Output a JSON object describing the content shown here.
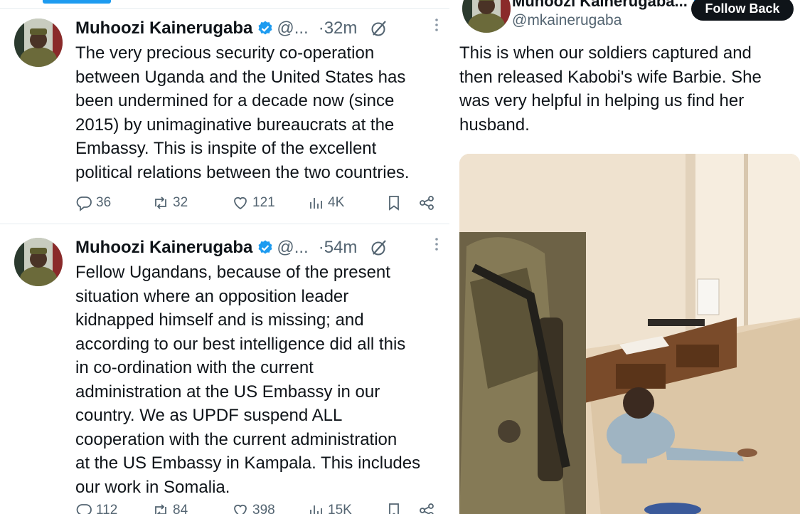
{
  "colors": {
    "text": "#0f1419",
    "muted": "#536471",
    "accent": "#1d9bf0",
    "button_bg": "#0f1419",
    "divider": "#e6ecf0"
  },
  "left_feed": {
    "tweets": [
      {
        "author": "Muhoozi Kainerugaba",
        "handle": "@...",
        "time": "·32m",
        "lines": [
          "The very precious security co-operation",
          "between Uganda and the United States has",
          "been undermined for a decade now (since",
          "2015) by unimaginative bureaucrats at the",
          "Embassy. This is inspite of the excellent",
          "political relations between the two countries."
        ],
        "replies": "36",
        "reposts": "32",
        "likes": "121",
        "views": "4K"
      },
      {
        "author": "Muhoozi Kainerugaba",
        "handle": "@...",
        "time": "·54m",
        "lines": [
          "Fellow Ugandans, because of the present",
          "situation where an opposition leader",
          "kidnapped himself and is missing; and",
          "according to our best intelligence did all this",
          "in co-ordination with the current",
          "administration at the US Embassy in our",
          "country. We as UPDF suspend ALL",
          "cooperation with the current administration",
          "at the US Embassy in Kampala. This includes",
          "our work in Somalia."
        ],
        "replies": "112",
        "reposts": "84",
        "likes": "398",
        "views": "15K"
      }
    ]
  },
  "right_post": {
    "author": "Muhoozi Kainerugaba...",
    "handle": "@mkainerugaba",
    "follow_label": "Follow Back",
    "lines": [
      "This is when our soldiers captured and",
      "then released Kabobi's wife Barbie. She",
      "was very helpful in helping us find her",
      "husband."
    ],
    "media_icon": "photo-soldier-room"
  },
  "icons": {
    "verified": "verified-badge-icon",
    "reply": "reply-icon",
    "repost": "repost-icon",
    "like": "heart-icon",
    "views": "views-icon",
    "bookmark": "bookmark-icon",
    "share": "share-icon",
    "more": "more-icon",
    "grok": "grok-icon"
  }
}
